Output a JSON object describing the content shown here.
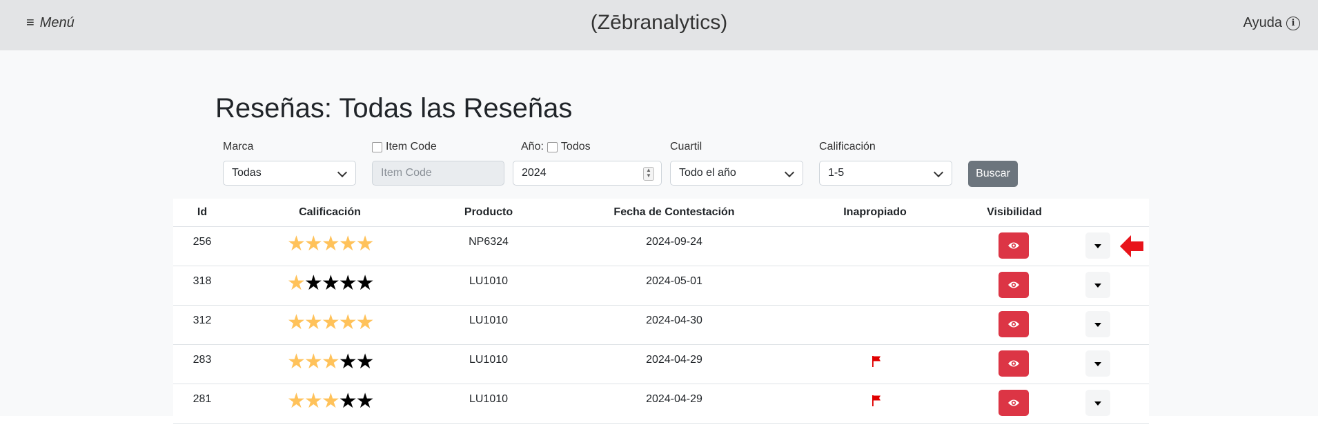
{
  "navbar": {
    "menu_icon": "hamburger-icon",
    "menu_label": "Menú",
    "brand": "(Zēbranalytics)",
    "help_label": "Ayuda",
    "help_icon": "info-icon",
    "help_icon_glyph": "i"
  },
  "page_title": "Reseñas: Todas las Reseñas",
  "filters": {
    "marca": {
      "label": "Marca",
      "value": "Todas"
    },
    "item_code": {
      "label": "Item Code",
      "placeholder": "Item Code",
      "checked": false
    },
    "anio": {
      "label": "Año:",
      "todos_label": "Todos",
      "value": "2024",
      "checked": false
    },
    "cuartil": {
      "label": "Cuartil",
      "value": "Todo el año"
    },
    "calificacion": {
      "label": "Calificación",
      "value": "1-5"
    },
    "search_label": "Buscar"
  },
  "table": {
    "headers": [
      "Id",
      "Calificación",
      "Producto",
      "Fecha de Contestación",
      "Inapropiado",
      "Visibilidad"
    ],
    "rows": [
      {
        "id": "256",
        "rating": 5,
        "product": "NP6324",
        "date": "2024-09-24",
        "inappropriate": false
      },
      {
        "id": "318",
        "rating": 1,
        "product": "LU1010",
        "date": "2024-05-01",
        "inappropriate": false
      },
      {
        "id": "312",
        "rating": 5,
        "product": "LU1010",
        "date": "2024-04-30",
        "inappropriate": false
      },
      {
        "id": "283",
        "rating": 3,
        "product": "LU1010",
        "date": "2024-04-29",
        "inappropriate": true
      },
      {
        "id": "281",
        "rating": 3,
        "product": "LU1010",
        "date": "2024-04-29",
        "inappropriate": true
      }
    ],
    "max_rating": 5
  },
  "colors": {
    "star_on": "#ffc25a",
    "star_off": "#000000",
    "eye_button": "#dc3545",
    "flag": "#e00000",
    "arrow": "#e8141b",
    "search_button": "#6c757d"
  },
  "icons": {
    "eye": "eye-icon",
    "flag": "flag-icon",
    "caret": "caret-down-icon",
    "arrow": "arrow-left-icon",
    "chevron": "chevron-down-icon"
  }
}
